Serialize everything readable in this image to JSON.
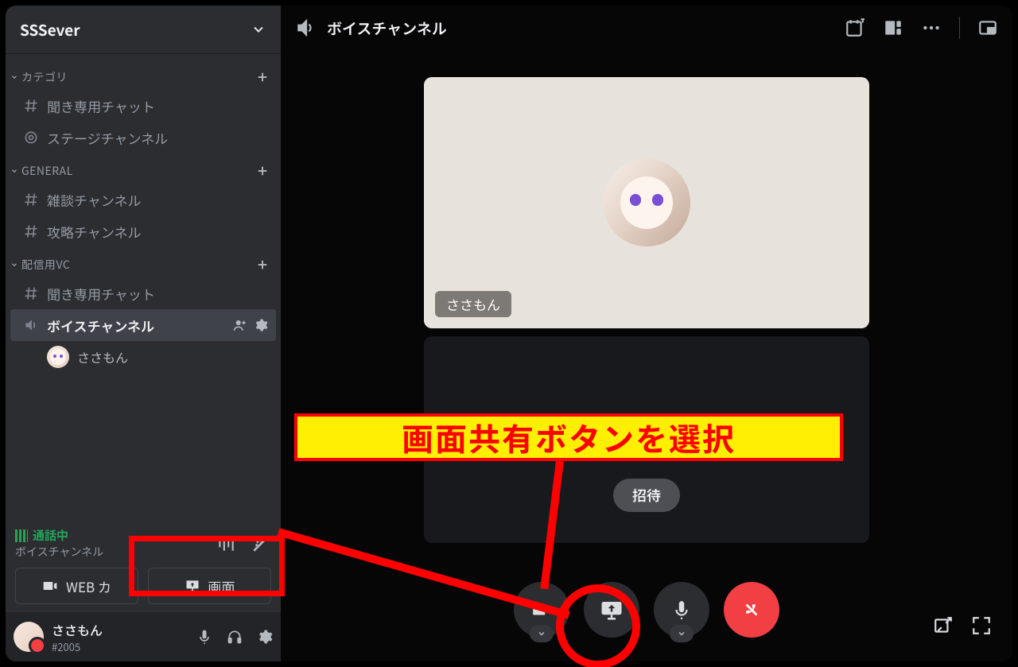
{
  "server": {
    "name": "SSSever"
  },
  "categories": [
    {
      "label": "カテゴリ",
      "channels": [
        {
          "type": "text",
          "label": "聞き専用チャット"
        },
        {
          "type": "stage",
          "label": "ステージチャンネル"
        }
      ]
    },
    {
      "label": "GENERAL",
      "channels": [
        {
          "type": "text",
          "label": "雑談チャンネル"
        },
        {
          "type": "text",
          "label": "攻略チャンネル"
        }
      ]
    },
    {
      "label": "配信用VC",
      "channels": [
        {
          "type": "text",
          "label": "聞き専用チャット"
        },
        {
          "type": "voice",
          "label": "ボイスチャンネル",
          "active": true,
          "members": [
            {
              "name": "ささもん"
            }
          ]
        }
      ]
    }
  ],
  "voice_panel": {
    "status": "通話中",
    "sub": "ボイスチャンネル",
    "buttons": {
      "camera": "WEB カ",
      "screen": "画面"
    }
  },
  "user": {
    "name": "ささもん",
    "tag": "#2005"
  },
  "call": {
    "title": "ボイスチャンネル",
    "participant": "ささもん",
    "invite": "招待"
  },
  "annotation": {
    "label": "画面共有ボタンを選択"
  }
}
